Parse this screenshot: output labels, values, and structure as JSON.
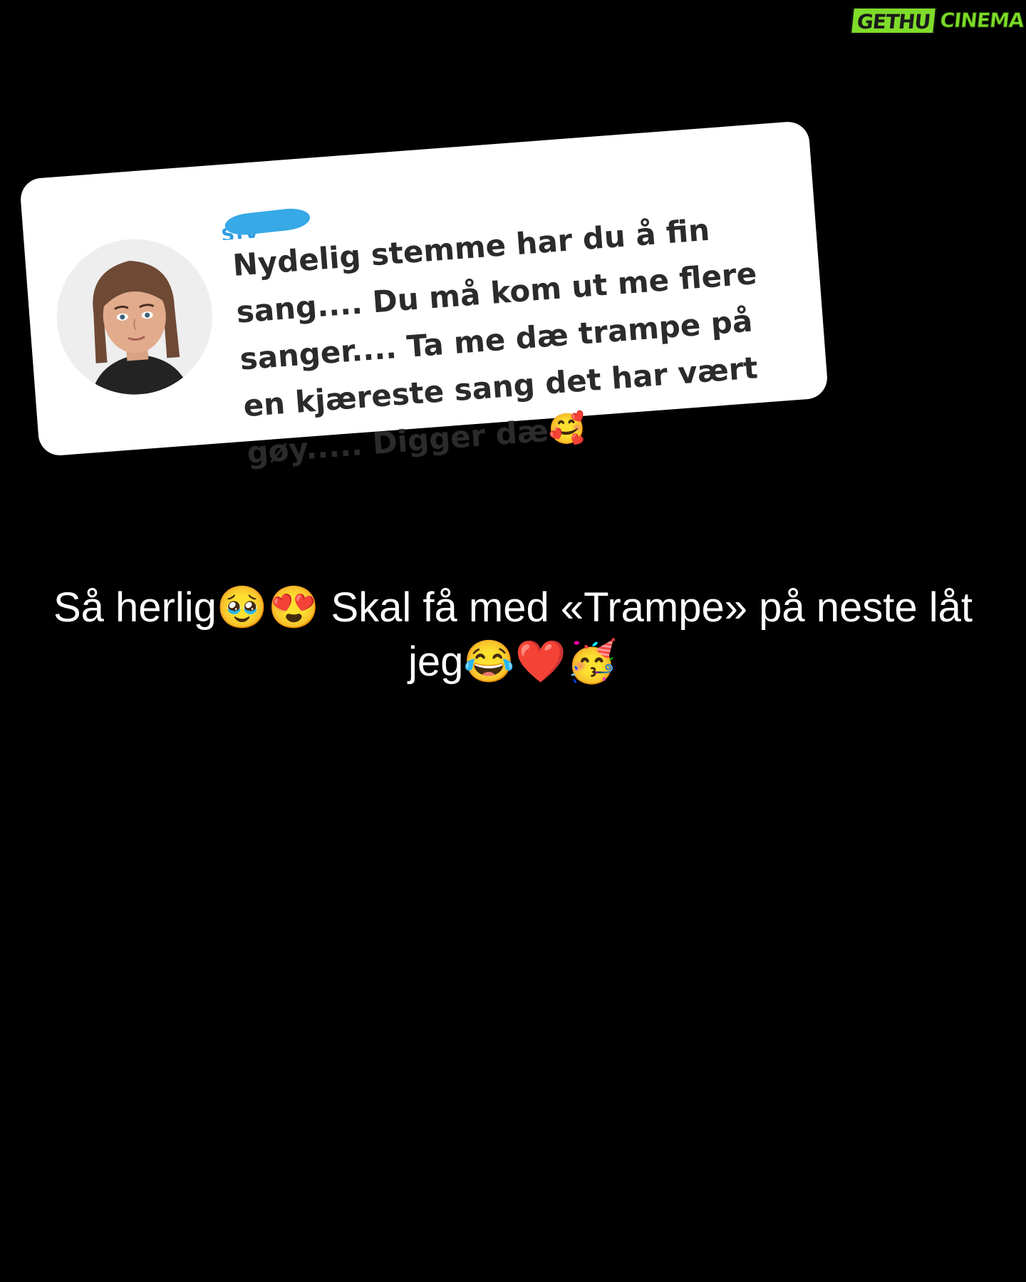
{
  "watermark": {
    "left": "GETHU",
    "right": "CINEMA",
    "accent_color": "#7fdc2a"
  },
  "comment": {
    "avatar_icon": "bitmoji-avatar-icon",
    "username_partial": "SIV",
    "text": "Nydelig stemme har du å fin sang.... Du må kom ut me flere sanger.... Ta me dæ trampe på en kjæreste sang det har vært gøy..... Digger dæ🥰"
  },
  "reply": {
    "text": "Så herlig🥹😍 Skal få med «Trampe» på neste låt jeg😂❤️🥳"
  },
  "colors": {
    "background": "#000000",
    "card": "#ffffff",
    "redaction": "#36a9e6"
  }
}
